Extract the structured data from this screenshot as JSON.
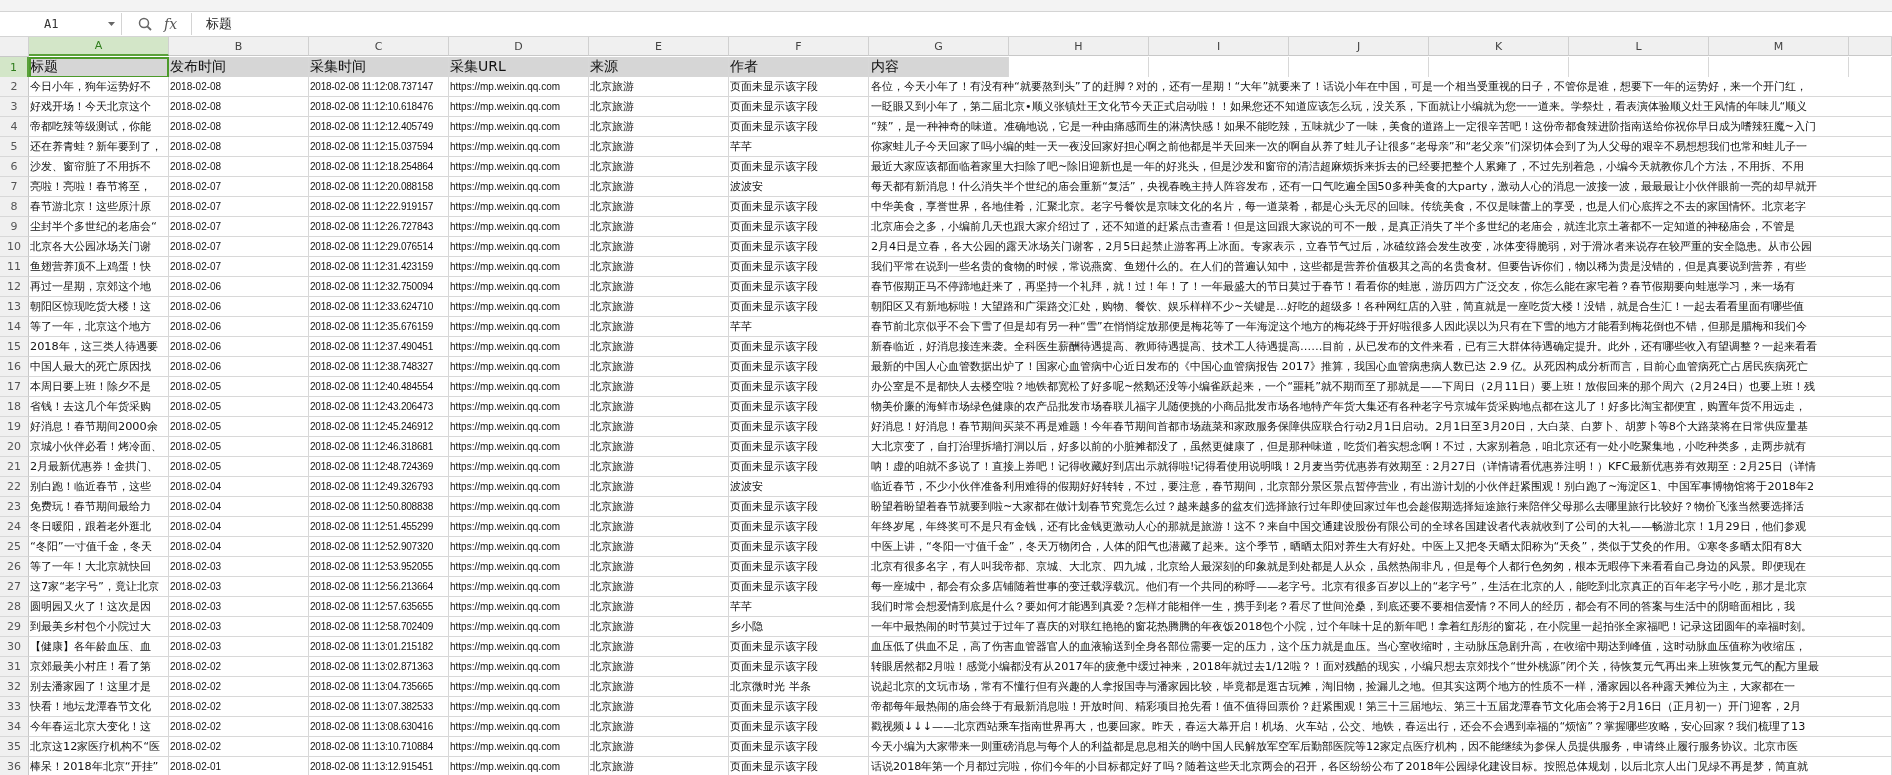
{
  "formula_bar": {
    "cell_ref": "A1",
    "fx_label": "fx",
    "formula": "标题"
  },
  "columns": [
    {
      "label": "A",
      "selected": true
    },
    {
      "label": "B",
      "selected": false
    },
    {
      "label": "C",
      "selected": false
    },
    {
      "label": "D",
      "selected": false
    },
    {
      "label": "E",
      "selected": false
    },
    {
      "label": "F",
      "selected": false
    },
    {
      "label": "G",
      "selected": false
    },
    {
      "label": "H",
      "selected": false
    },
    {
      "label": "I",
      "selected": false
    },
    {
      "label": "J",
      "selected": false
    },
    {
      "label": "K",
      "selected": false
    },
    {
      "label": "L",
      "selected": false
    },
    {
      "label": "M",
      "selected": false
    }
  ],
  "rows": [
    {
      "number": "1",
      "selected": true,
      "cells": [
        "标题",
        "发布时间",
        "采集时间",
        "采集URL",
        "来源",
        "作者",
        "内容"
      ]
    },
    {
      "number": "2",
      "selected": false,
      "cells": [
        "今日小年，狗年运势好不",
        "2018-02-08",
        "2018-02-08 11:12:08.737147",
        "https://mp.weixin.qq.com",
        "北京旅游",
        "页面未显示该字段",
        "各位，今天小年了！有没有种“就要熬到头”了的赶脚？对的，还有一星期！“大年”就要来了！话说小年在中国，可是一个相当受重视的日子，不管你是谁，想要下一年的运势好，来一个开门红，"
      ]
    },
    {
      "number": "3",
      "selected": false,
      "cells": [
        "好戏开场！今天北京这个",
        "2018-02-08",
        "2018-02-08 11:12:10.618476",
        "https://mp.weixin.qq.com",
        "北京旅游",
        "页面未显示该字段",
        "一眨眼又到小年了，第二届北京•顺义张镇灶王文化节今天正式启动啦！！如果您还不知道应该怎么玩，没关系，下面就让小编就为您一一道来。学祭灶，看表演体验顺义灶王风情的年味儿“顺义"
      ]
    },
    {
      "number": "4",
      "selected": false,
      "cells": [
        "帝都吃辣等级测试，你能",
        "2018-02-08",
        "2018-02-08 11:12:12.405749",
        "https://mp.weixin.qq.com",
        "北京旅游",
        "页面未显示该字段",
        "“辣”，是一种神奇的味道。准确地说，它是一种由痛感而生的淋漓快感！如果不能吃辣，五味就少了一味，美食的道路上一定很辛苦吧！这份帝都食辣进阶指南送给你祝你早日成为嗜辣狂魔~入门"
      ]
    },
    {
      "number": "5",
      "selected": false,
      "cells": [
        "还在养青蛙？新年要到了，",
        "2018-02-08",
        "2018-02-08 11:12:15.037594",
        "https://mp.weixin.qq.com",
        "北京旅游",
        "芊芊",
        "你家蛙儿子今天回家了吗小编的蛙一天一夜没回家好担心啊之前他都是半天回来一次的啊自从养了蛙儿子让很多“老母亲”和“老父亲”们深切体会到了为人父母的艰辛不易想想我们也常和蛙儿子一"
      ]
    },
    {
      "number": "6",
      "selected": false,
      "cells": [
        "沙发、窗帘脏了不用拆不",
        "2018-02-08",
        "2018-02-08 11:12:18.254864",
        "https://mp.weixin.qq.com",
        "北京旅游",
        "页面未显示该字段",
        "最近大家应该都面临着家里大扫除了吧~除旧迎新也是一年的好兆头，但是沙发和窗帘的清洁超麻烦拆来拆去的已经要把整个人累瘫了，不过先别着急，小编今天就教你几个方法，不用拆、不用"
      ]
    },
    {
      "number": "7",
      "selected": false,
      "cells": [
        "亮啦！亮啦！春节将至，",
        "2018-02-07",
        "2018-02-08 11:12:20.088158",
        "https://mp.weixin.qq.com",
        "北京旅游",
        "波波安",
        "每天都有新消息！什么消失半个世纪的庙会重新“复活”，央视春晚主持人阵容发布，还有一口气吃遍全国50多种美食的大party，激动人心的消息一波接一波，最最最让小伙伴眼前一亮的却早就开"
      ]
    },
    {
      "number": "8",
      "selected": false,
      "cells": [
        "春节游北京！这些原汁原",
        "2018-02-07",
        "2018-02-08 11:12:22.919157",
        "https://mp.weixin.qq.com",
        "北京旅游",
        "页面未显示该字段",
        "中华美食，享誉世界，各地佳肴，汇聚北京。老字号餐饮是京味文化的名片，每一道菜肴，都是心头无尽的回味。传统美食，不仅是味蕾上的享受，也是人们心底挥之不去的家国情怀。北京老字"
      ]
    },
    {
      "number": "9",
      "selected": false,
      "cells": [
        "尘封半个多世纪的老庙会“",
        "2018-02-07",
        "2018-02-08 11:12:26.727843",
        "https://mp.weixin.qq.com",
        "北京旅游",
        "页面未显示该字段",
        "北京庙会之多，小编前几天也跟大家介绍过了，还不知道的赶紧点击查看！但是这回跟大家说的可不一般，是真正消失了半个多世纪的老庙会，就连北京土著都不一定知道的神秘庙会，不管是"
      ]
    },
    {
      "number": "10",
      "selected": false,
      "cells": [
        "北京各大公园冰场关门谢",
        "2018-02-07",
        "2018-02-08 11:12:29.076514",
        "https://mp.weixin.qq.com",
        "北京旅游",
        "页面未显示该字段",
        "2月4日是立春，各大公园的露天冰场关门谢客，2月5日起禁止游客再上冰面。专家表示，立春节气过后，冰碴纹路会发生改变，冰体变得脆弱，对于滑冰者来说存在较严重的安全隐患。从市公园"
      ]
    },
    {
      "number": "11",
      "selected": false,
      "cells": [
        "鱼翅营养顶不上鸡蛋！快",
        "2018-02-07",
        "2018-02-08 11:12:31.423159",
        "https://mp.weixin.qq.com",
        "北京旅游",
        "页面未显示该字段",
        "我们平常在说到一些名贵的食物的时候，常说燕窝、鱼翅什么的。在人们的普遍认知中，这些都是营养价值极其之高的名贵食材。但要告诉你们，物以稀为贵是没错的，但是真要说到营养，有些"
      ]
    },
    {
      "number": "12",
      "selected": false,
      "cells": [
        "再过一星期，京郊这个地",
        "2018-02-06",
        "2018-02-08 11:12:32.750094",
        "https://mp.weixin.qq.com",
        "北京旅游",
        "页面未显示该字段",
        "春节假期正马不停蹄地赶来了，再坚持一个礼拜，就！过！年！了！一年最盛大的节日莫过于春节！看看你的蛙崽，游历四方广泛交友，你怎么能在家宅着？春节假期要向蛙崽学习，来一场有"
      ]
    },
    {
      "number": "13",
      "selected": false,
      "cells": [
        "朝阳区惊现吃货大楼！这",
        "2018-02-06",
        "2018-02-08 11:12:33.624710",
        "https://mp.weixin.qq.com",
        "北京旅游",
        "页面未显示该字段",
        "朝阳区又有新地标啦！大望路和广渠路交汇处，购物、餐饮、娱乐样样不少~关键是...好吃的超级多！各种网红店的入驻，简直就是一座吃货大楼！没错，就是合生汇！一起去看看里面有哪些值"
      ]
    },
    {
      "number": "14",
      "selected": false,
      "cells": [
        "等了一年，北京这个地方",
        "2018-02-06",
        "2018-02-08 11:12:35.676159",
        "https://mp.weixin.qq.com",
        "北京旅游",
        "芊芊",
        "春节前北京似乎不会下雪了但是却有另一种“雪”在悄悄绽放那便是梅花等了一年海淀这个地方的梅花终于开好啦很多人因此误以为只有在下雪的地方才能看到梅花倒也不错，但那是腊梅和我们今"
      ]
    },
    {
      "number": "15",
      "selected": false,
      "cells": [
        "2018年，这三类人待遇要",
        "2018-02-06",
        "2018-02-08 11:12:37.490451",
        "https://mp.weixin.qq.com",
        "北京旅游",
        "页面未显示该字段",
        "新春临近，好消息接连来袭。全科医生薪酬待遇提高、教师待遇提高、技术工人待遇提高……目前，从已发布的文件来看，已有三大群体待遇确定提升。此外，还有哪些收入有望调整？一起来看看"
      ]
    },
    {
      "number": "16",
      "selected": false,
      "cells": [
        "中国人最大的死亡原因找",
        "2018-02-06",
        "2018-02-08 11:12:38.748327",
        "https://mp.weixin.qq.com",
        "北京旅游",
        "页面未显示该字段",
        "最新的中国人心血管数据出炉了！国家心血管病中心近日发布的《中国心血管病报告 2017》推算，我国心血管病患病人数已达 2.9 亿。从死因构成分析而言，目前心血管病死亡占居民疾病死亡"
      ]
    },
    {
      "number": "17",
      "selected": false,
      "cells": [
        "本周日要上班！除夕不是",
        "2018-02-05",
        "2018-02-08 11:12:40.484554",
        "https://mp.weixin.qq.com",
        "北京旅游",
        "页面未显示该字段",
        "办公室是不是都快人去楼空啦？地铁都宽松了好多呢~然鹅还没等小编雀跃起来，一个“噩耗”就不期而至了那就是——下周日（2月11日）要上班！放假回来的那个周六（2月24日）也要上班！残"
      ]
    },
    {
      "number": "18",
      "selected": false,
      "cells": [
        "省钱！去这几个年货采购",
        "2018-02-05",
        "2018-02-08 11:12:43.206473",
        "https://mp.weixin.qq.com",
        "北京旅游",
        "页面未显示该字段",
        "物美价廉的海鲜市场绿色健康的农产品批发市场春联儿福字儿随便挑的小商品批发市场各地特产年货大集还有各种老字号京城年货采购地点都在这儿了！好多比淘宝都便宜，购置年货不用远走，"
      ]
    },
    {
      "number": "19",
      "selected": false,
      "cells": [
        "好消息！春节期间2000余",
        "2018-02-05",
        "2018-02-08 11:12:45.246912",
        "https://mp.weixin.qq.com",
        "北京旅游",
        "页面未显示该字段",
        "好消息！好消息！春节期间买菜不再是难题！今年春节期间首都市场蔬菜和家政服务保障供应联合行动2月1日启动。2月1日至3月20日，大白菜、白萝卜、胡萝卜等8个大路菜将在日常供应量基"
      ]
    },
    {
      "number": "20",
      "selected": false,
      "cells": [
        "京城小伙伴必看！烤冷面、",
        "2018-02-05",
        "2018-02-08 11:12:46.318681",
        "https://mp.weixin.qq.com",
        "北京旅游",
        "页面未显示该字段",
        "大北京变了，自打治理拆墙打洞以后，好多以前的小脏摊都没了，虽然更健康了，但是那种味道，吃货们着实想念啊！不过，大家别着急，咱北京还有一处小吃聚集地，小吃种类多，走两步就有"
      ]
    },
    {
      "number": "21",
      "selected": false,
      "cells": [
        "2月最新优惠券！金拱门、",
        "2018-02-05",
        "2018-02-08 11:12:48.724369",
        "https://mp.weixin.qq.com",
        "北京旅游",
        "页面未显示该字段",
        "呐！虚的咱就不多说了！直接上券吧！记得收藏好到店出示就得啦!记得看使用说明哦！2月麦当劳优惠券有效期至：2月27日（详情请看优惠券注明！）KFC最新优惠券有效期至：2月25日（详情"
      ]
    },
    {
      "number": "22",
      "selected": false,
      "cells": [
        "别白跑！临近春节，这些",
        "2018-02-04",
        "2018-02-08 11:12:49.326793",
        "https://mp.weixin.qq.com",
        "北京旅游",
        "波波安",
        "临近春节，不少小伙伴准备利用难得的假期好好转转，不过，要注意，春节期间，北京部分景区景点暂停营业，有出游计划的小伙伴赶紧围观！别白跑了~海淀区1、中国军事博物馆将于2018年2"
      ]
    },
    {
      "number": "23",
      "selected": false,
      "cells": [
        "免费玩！春节期间最给力",
        "2018-02-04",
        "2018-02-08 11:12:50.808838",
        "https://mp.weixin.qq.com",
        "北京旅游",
        "页面未显示该字段",
        "盼望着盼望着春节就要到啦~大家都在做计划春节究竟怎么过？越来越多的盆友们选择旅行过年即使回家过年也会趁假期选择短途旅行来陪伴父母那么去哪里旅行比较好？物价飞涨当然要选择活"
      ]
    },
    {
      "number": "24",
      "selected": false,
      "cells": [
        "冬日暖阳，跟着老外逛北",
        "2018-02-04",
        "2018-02-08 11:12:51.455299",
        "https://mp.weixin.qq.com",
        "北京旅游",
        "页面未显示该字段",
        "年终岁尾，年终奖可不是只有金钱，还有比金钱更激动人心的那就是旅游！这不？来自中国交通建设股份有限公司的全球各国建设者代表就收到了公司的大礼——畅游北京！1月29日，他们参观"
      ]
    },
    {
      "number": "25",
      "selected": false,
      "cells": [
        "“冬阳”一寸值千金，冬天",
        "2018-02-04",
        "2018-02-08 11:12:52.907320",
        "https://mp.weixin.qq.com",
        "北京旅游",
        "页面未显示该字段",
        "中医上讲，“冬阳一寸值千金”，冬天万物闭合，人体的阳气也潜藏了起来。这个季节，晒晒太阳对养生大有好处。中医上又把冬天晒太阳称为“天灸”，类似于艾灸的作用。①寒冬多晒太阳有8大"
      ]
    },
    {
      "number": "26",
      "selected": false,
      "cells": [
        "等了一年！大北京就快回",
        "2018-02-03",
        "2018-02-08 11:12:53.952055",
        "https://mp.weixin.qq.com",
        "北京旅游",
        "页面未显示该字段",
        "北京有很多名字，有人叫我帝都、京城、大北京、四九城，北京给人最深刻的印象就是到处都是人从众，虽然热闹非凡，但是每个人都行色匆匆，根本无暇停下来看看自己身边的风景。即便现在"
      ]
    },
    {
      "number": "27",
      "selected": false,
      "cells": [
        "这7家“老字号”，竟让北京",
        "2018-02-03",
        "2018-02-08 11:12:56.213664",
        "https://mp.weixin.qq.com",
        "北京旅游",
        "页面未显示该字段",
        "每一座城中，都会有众多店铺随着世事的变迁载浮载沉。他们有一个共同的称呼——老字号。北京有很多百岁以上的“老字号”，生活在北京的人，能吃到北京真正的百年老字号小吃，那才是北京"
      ]
    },
    {
      "number": "28",
      "selected": false,
      "cells": [
        "圆明园又火了！这次是因",
        "2018-02-03",
        "2018-02-08 11:12:57.635655",
        "https://mp.weixin.qq.com",
        "北京旅游",
        "芊芊",
        "我们时常会想爱情到底是什么？要如何才能遇到真爱？怎样才能相伴一生，携手到老？看尽了世间沧桑，到底还要不要相信爱情？不同人的经历，都会有不同的答案与生活中的阴暗面相比，我"
      ]
    },
    {
      "number": "29",
      "selected": false,
      "cells": [
        "到最美乡村包个小院过大",
        "2018-02-03",
        "2018-02-08 11:12:58.702409",
        "https://mp.weixin.qq.com",
        "北京旅游",
        "乡小隐",
        "一年中最热闹的时节莫过于过年了喜庆的对联红艳艳的窗花热腾腾的年夜饭2018包个小院，过个年味十足的新年吧！拿着红彤彤的窗花，在小院里一起拍张全家福吧！记录这团圆年的幸福时刻。"
      ]
    },
    {
      "number": "30",
      "selected": false,
      "cells": [
        "【健康】各年龄血压、血",
        "2018-02-03",
        "2018-02-08 11:13:01.215182",
        "https://mp.weixin.qq.com",
        "北京旅游",
        "页面未显示该字段",
        "血压低了供血不足，高了伤害血管器官人的血液输送到全身各部位需要一定的压力，这个压力就是血压。当心室收缩时，主动脉压急剧升高，在收缩中期达到峰值，这时动脉血压值称为收缩压，"
      ]
    },
    {
      "number": "31",
      "selected": false,
      "cells": [
        "京郊最美小村庄！看了第",
        "2018-02-02",
        "2018-02-08 11:13:02.871363",
        "https://mp.weixin.qq.com",
        "北京旅游",
        "页面未显示该字段",
        "转眼居然都2月啦！感觉小编都没有从2017年的疲惫中缓过神来，2018年就过去1/12啦？！面对残酷的现实，小编只想去京郊找个“世外桃源”闭个关，待恢复元气再出来上班恢复元气的配方里最"
      ]
    },
    {
      "number": "32",
      "selected": false,
      "cells": [
        "别去潘家园了！这里才是",
        "2018-02-02",
        "2018-02-08 11:13:04.735665",
        "https://mp.weixin.qq.com",
        "北京旅游",
        "北京微时光 半条",
        "说起北京的文玩市场，常有不懂行但有兴趣的人拿报国寺与潘家园比较，毕竟都是逛古玩摊，淘旧物，捡漏儿之地。但其实这两个地方的性质不一样，潘家园以各种露天摊位为主，大家都在一"
      ]
    },
    {
      "number": "33",
      "selected": false,
      "cells": [
        "快看！地坛龙潭春节文化",
        "2018-02-02",
        "2018-02-08 11:13:07.382533",
        "https://mp.weixin.qq.com",
        "北京旅游",
        "页面未显示该字段",
        "帝都每年最热闹的庙会终于有最新消息啦！开放时间、精彩项目抢先看！值不值得回票价？赶紧围观！第三十三届地坛、第三十五届龙潭春节文化庙会将于2月16日（正月初一）开门迎客，2月"
      ]
    },
    {
      "number": "34",
      "selected": false,
      "cells": [
        "今年春运北京大变化！这",
        "2018-02-02",
        "2018-02-08 11:13:08.630416",
        "https://mp.weixin.qq.com",
        "北京旅游",
        "页面未显示该字段",
        "戳视频↓↓↓——北京西站乘车指南世界再大，也要回家。昨天，春运大幕开启！机场、火车站，公交、地铁，春运出行，还会不会遇到幸福的“烦恼”？掌握哪些攻略，安心回家？我们梳理了13"
      ]
    },
    {
      "number": "35",
      "selected": false,
      "cells": [
        "北京这12家医疗机构不“医",
        "2018-02-02",
        "2018-02-08 11:13:10.710884",
        "https://mp.weixin.qq.com",
        "北京旅游",
        "页面未显示该字段",
        "今天小编为大家带来一则重磅消息与每个人的利益都是息息相关的哟中国人民解放军空军后勤部医院等12家定点医疗机构，因不能继续为参保人员提供服务，申请终止履行服务协议。北京市医"
      ]
    },
    {
      "number": "36",
      "selected": false,
      "cells": [
        "棒呆！2018年北京“开挂”",
        "2018-02-01",
        "2018-02-08 11:13:12.915451",
        "https://mp.weixin.qq.com",
        "北京旅游",
        "页面未显示该字段",
        "话说2018年第一个月都过完啦，你们今年的小目标都定好了吗？随着这些天北京两会的召开，各区纷纷公布了2018年公园绿化建设目标。按照总体规划，以后北京人出门见绿不再是梦，简直就"
      ]
    }
  ]
}
